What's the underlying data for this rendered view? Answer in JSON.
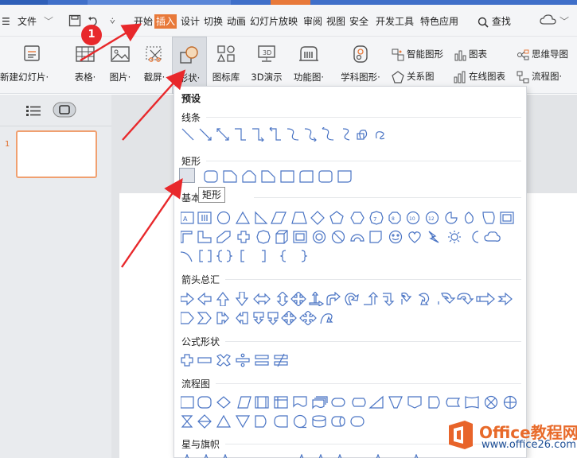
{
  "menubar": {
    "file_menu": "文件",
    "tabs": [
      {
        "label": "开始"
      },
      {
        "label": "插入",
        "active": true
      },
      {
        "label": "设计"
      },
      {
        "label": "切换"
      },
      {
        "label": "动画"
      },
      {
        "label": "幻灯片放映"
      },
      {
        "label": "审阅"
      },
      {
        "label": "视图"
      },
      {
        "label": "安全"
      },
      {
        "label": "开发工具"
      },
      {
        "label": "特色应用"
      }
    ],
    "search_label": "查找",
    "active_tab_color": "#e8793a"
  },
  "ribbon": {
    "new_slide": "新建幻灯片",
    "table": "表格",
    "picture": "图片",
    "screenshot": "截屏",
    "shape": "形状",
    "icon_library": "图标库",
    "demo_3d": "3D演示",
    "function_chart": "功能图",
    "subject_shape": "学科图形",
    "smart_shape": "智能图形",
    "chart": "图表",
    "mind_map": "思维导图",
    "relation_chart": "关系图",
    "online_chart": "在线图表",
    "flowchart": "流程图"
  },
  "slides_panel": {
    "slide_number": "1"
  },
  "shape_dropdown": {
    "preset_title": "预设",
    "sections": {
      "lines": "线条",
      "rectangles": "矩形",
      "basic_prefix": "基本",
      "arrows": "箭头总汇",
      "equation": "公式形状",
      "flowchart": "流程图",
      "stars": "星与旗帜"
    },
    "tooltip": "矩形",
    "shape_stroke_color": "#4a74c4"
  },
  "annotation": {
    "step_number": "1",
    "arrow_color": "#e8282b"
  },
  "watermark": {
    "line1": "Office教程网",
    "line2": "www.office26.com"
  }
}
